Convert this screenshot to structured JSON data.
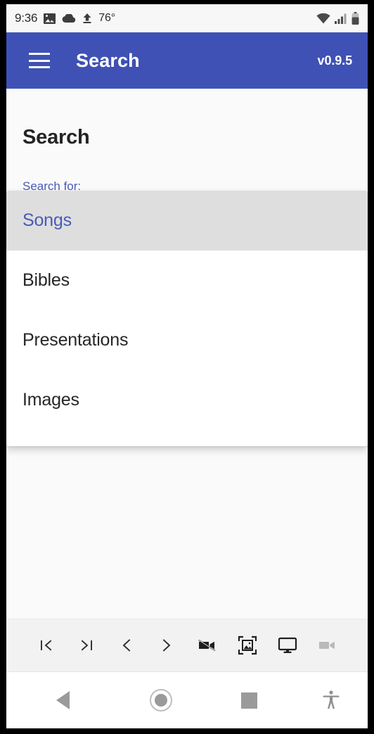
{
  "status_bar": {
    "time": "9:36",
    "temperature": "76°",
    "icons": [
      "photo-icon",
      "cloud-icon",
      "upload-icon",
      "wifi-icon",
      "cellular-signal-icon",
      "battery-icon"
    ]
  },
  "app_bar": {
    "menu_icon": "hamburger-menu-icon",
    "title": "Search",
    "version": "v0.9.5",
    "background_color": "#3f51b5",
    "text_color": "#ffffff"
  },
  "page": {
    "title": "Search",
    "field_label": "Search for:",
    "label_color": "#4a5ab8",
    "background_color": "#fafafa"
  },
  "dropdown": {
    "open": true,
    "selected": "Songs",
    "selected_bg": "#dedede",
    "selected_color": "#4a5ab8",
    "options": [
      {
        "label": "Songs",
        "selected": true
      },
      {
        "label": "Bibles",
        "selected": false
      },
      {
        "label": "Presentations",
        "selected": false
      },
      {
        "label": "Images",
        "selected": false
      }
    ]
  },
  "toolbar": {
    "background_color": "#f2f2f2",
    "buttons": [
      {
        "name": "first-page-icon",
        "label": "|<",
        "enabled": true
      },
      {
        "name": "last-page-icon",
        "label": ">|",
        "enabled": true
      },
      {
        "name": "previous-page-icon",
        "label": "<",
        "enabled": true
      },
      {
        "name": "next-page-icon",
        "label": ">",
        "enabled": true
      },
      {
        "name": "videocam-off-icon",
        "label": "Videocam off",
        "enabled": true
      },
      {
        "name": "add-photo-frame-icon",
        "label": "Image frame",
        "enabled": true
      },
      {
        "name": "desktop-monitor-icon",
        "label": "Display",
        "enabled": true
      },
      {
        "name": "videocam-icon",
        "label": "Videocam",
        "enabled": false
      }
    ]
  },
  "nav_bar": {
    "buttons": [
      {
        "name": "android-back-icon",
        "label": "Back"
      },
      {
        "name": "android-home-icon",
        "label": "Home"
      },
      {
        "name": "android-recents-icon",
        "label": "Recents"
      },
      {
        "name": "accessibility-icon",
        "label": "Accessibility"
      }
    ]
  }
}
